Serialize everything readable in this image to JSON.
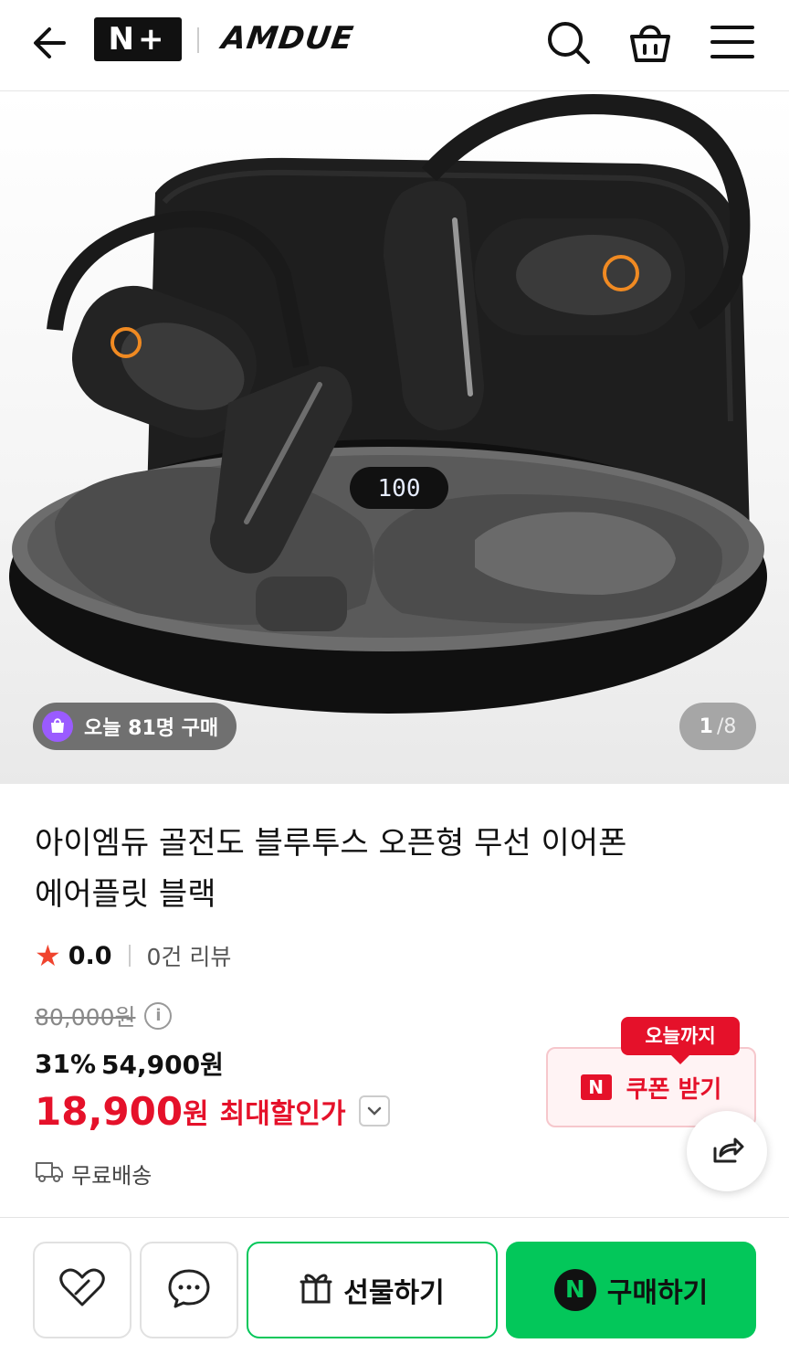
{
  "header": {
    "badge": "N+",
    "brand": "AMDUE",
    "icons": [
      "back-arrow-icon",
      "search-icon",
      "shopping-bag-icon",
      "menu-icon"
    ]
  },
  "gallery": {
    "buyers_today": "오늘 81명 구매",
    "current": "1",
    "separator": "/",
    "total": "8",
    "case_display": "100"
  },
  "product": {
    "title_line1": "아이엠듀 골전도 블루투스 오픈형 무선 이어폰",
    "title_line2": "에어플릿 블랙",
    "rating": "0.0",
    "reviews": "0건 리뷰",
    "original_price": "80,000원",
    "discount_pct": "31%",
    "sale_price": "54,900원",
    "max_price_value": "18,900",
    "max_price_won": "원",
    "max_price_label": "최대할인가",
    "shipping": "무료배송"
  },
  "coupon": {
    "tag": "오늘까지",
    "logo": "N",
    "label": "쿠폰 받기"
  },
  "bottom": {
    "gift_label": "선물하기",
    "buy_logo": "N",
    "buy_label": "구매하기"
  },
  "colors": {
    "accent_red": "#e5112a",
    "naver_green": "#03c75a",
    "chip_purple": "#9a5bff"
  }
}
